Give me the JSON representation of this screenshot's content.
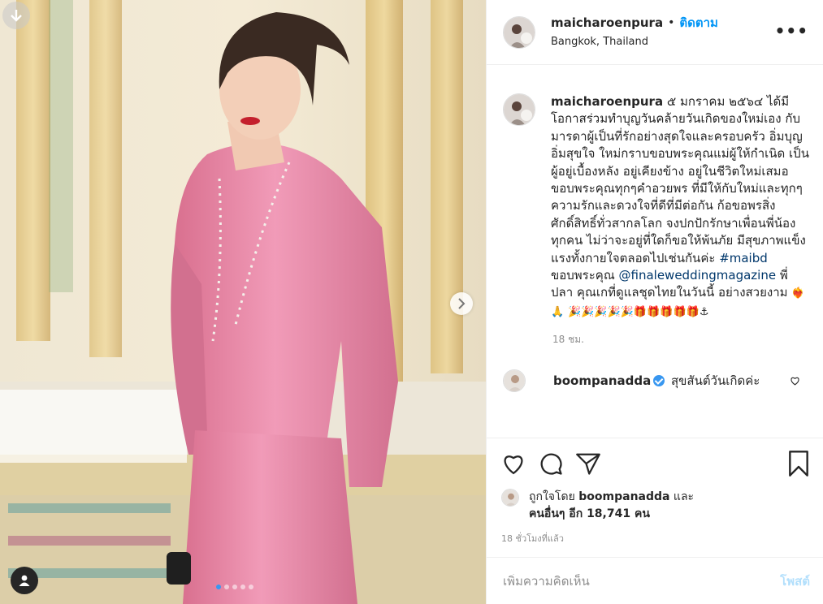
{
  "post": {
    "username": "maicharoenpura",
    "separator": "•",
    "follow_label": "ติดตาม",
    "location": "Bangkok, Thailand",
    "more_icon": "more-horizontal-icon"
  },
  "caption": {
    "username": "maicharoenpura",
    "text_1": " ๕ มกราคม ๒๕๖๔ ได้มีโอกาสร่วมทำบุญวันคล้ายวันเกิดของใหม่เอง กับมารดาผู้เป็นที่รักอย่างสุดใจและครอบครัว อิ่มบุญอิ่มสุขใจ ใหม่กราบขอบพระคุณแม่ผู้ให้กำเนิด เป็นผู้อยู่เบื้องหลัง อยู่เคียงข้าง อยู่ในชีวิตใหม่เสมอ ขอบพระคุณทุกๆคำอวยพร ที่มีให้กับใหม่และทุกๆความรักและดวงใจที่ดีที่มีต่อกัน ก้อขอพรสิ่งศักดิ์สิทธิ์ทั่วสากลโลก จงปกปักรักษาเพื่อนพี่น้องทุกคน ไม่ว่าจะอยู่ที่ใดก็ขอให้พ้นภัย มีสุขภาพแข็งแรงทั้งกายใจตลอดไปเช่นกันค่ะ ",
    "hashtag": "#maibd",
    "text_2": " ขอบพระคุณ ",
    "mention": "@finaleweddingmagazine",
    "text_3": " พี่ปลา คุณเกที่ดูแลชุดไทยในวันนี้ อย่างสวยงาม ",
    "emoji_1": "❤️‍🔥🙏",
    "emoji_2": "🎉🎉🎉🎉🎉🎁🎁🎁🎁🎁⚓",
    "time": "18 ชม."
  },
  "reply": {
    "username": "boompanadda",
    "text": " สุขสันต์วันเกิดค่ะ"
  },
  "likes": {
    "prefix": "ถูกใจโดย ",
    "user": "boompanadda",
    "and": " และ",
    "others": "คนอื่นๆ อีก 18,741 คน",
    "ago": "18 ชั่วโมงที่แล้ว"
  },
  "comment_box": {
    "placeholder": "เพิ่มความคิดเห็น",
    "post_label": "โพสต์"
  },
  "colors": {
    "accent": "#0095f6",
    "outfit": "#e88fb0"
  }
}
